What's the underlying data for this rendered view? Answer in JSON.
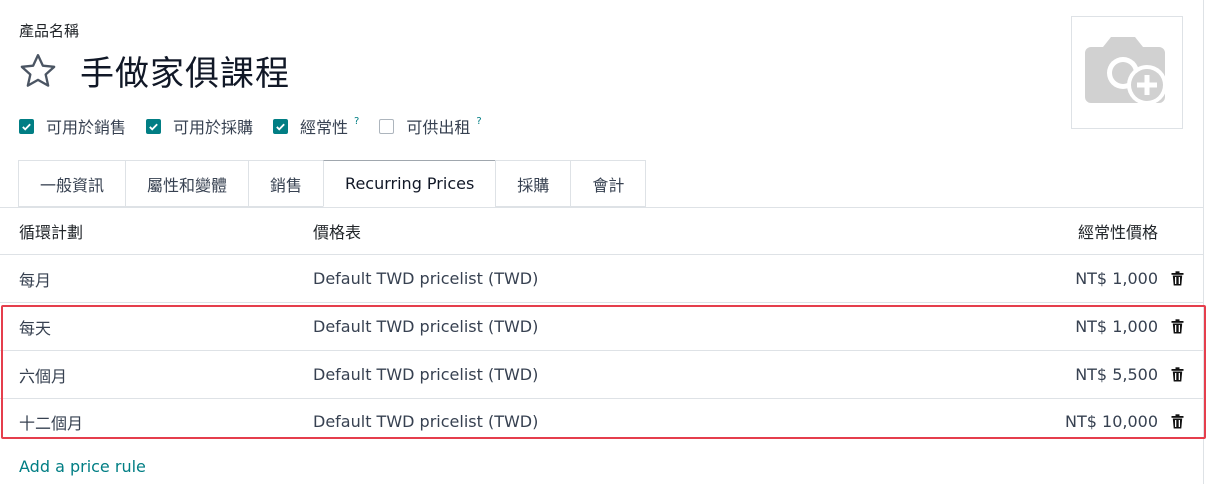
{
  "product": {
    "field_label": "產品名稱",
    "name": "手做家俱課程"
  },
  "options": [
    {
      "label": "可用於銷售",
      "checked": true,
      "help": ""
    },
    {
      "label": "可用於採購",
      "checked": true,
      "help": ""
    },
    {
      "label": "經常性",
      "checked": true,
      "help": "?"
    },
    {
      "label": "可供出租",
      "checked": false,
      "help": "?"
    }
  ],
  "tabs": [
    {
      "label": "一般資訊",
      "active": false
    },
    {
      "label": "屬性和變體",
      "active": false
    },
    {
      "label": "銷售",
      "active": false
    },
    {
      "label": "Recurring Prices",
      "active": true
    },
    {
      "label": "採購",
      "active": false
    },
    {
      "label": "會計",
      "active": false
    }
  ],
  "table": {
    "columns": [
      "循環計劃",
      "價格表",
      "經常性價格"
    ],
    "rows": [
      {
        "plan": "每月",
        "pricelist": "Default TWD pricelist (TWD)",
        "price": "NT$ 1,000"
      },
      {
        "plan": "每天",
        "pricelist": "Default TWD pricelist (TWD)",
        "price": "NT$ 1,000"
      },
      {
        "plan": "六個月",
        "pricelist": "Default TWD pricelist (TWD)",
        "price": "NT$ 5,500"
      },
      {
        "plan": "十二個月",
        "pricelist": "Default TWD pricelist (TWD)",
        "price": "NT$ 10,000"
      }
    ],
    "add_rule": "Add a price rule"
  },
  "colors": {
    "accent": "#017e84",
    "highlight": "#e53e4c"
  },
  "icons": {
    "favorite": "star-icon",
    "photo": "camera-plus-icon",
    "delete": "trash-icon"
  }
}
